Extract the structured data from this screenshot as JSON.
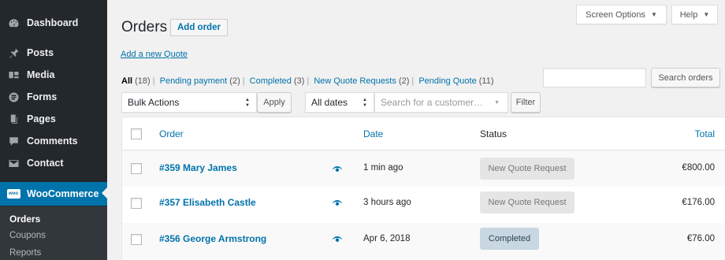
{
  "sidebar": {
    "items": [
      {
        "label": "Dashboard",
        "icon": "dashboard-icon"
      },
      {
        "label": "Posts",
        "icon": "pin-icon"
      },
      {
        "label": "Media",
        "icon": "media-icon"
      },
      {
        "label": "Forms",
        "icon": "forms-icon"
      },
      {
        "label": "Pages",
        "icon": "pages-icon"
      },
      {
        "label": "Comments",
        "icon": "comment-icon"
      },
      {
        "label": "Contact",
        "icon": "mail-icon"
      },
      {
        "label": "WooCommerce",
        "icon": "woocommerce-icon",
        "badge": "woo"
      }
    ],
    "submenu": [
      "Orders",
      "Coupons",
      "Reports"
    ]
  },
  "top": {
    "screen_options": "Screen Options",
    "help": "Help"
  },
  "header": {
    "title": "Orders",
    "add_order": "Add order",
    "quote_link": "Add a new Quote"
  },
  "filters": {
    "views": [
      {
        "label": "All",
        "count": "(18)"
      },
      {
        "label": "Pending payment",
        "count": "(2)"
      },
      {
        "label": "Completed",
        "count": "(3)"
      },
      {
        "label": "New Quote Requests",
        "count": "(2)"
      },
      {
        "label": "Pending Quote",
        "count": "(11)"
      }
    ],
    "search_button": "Search orders",
    "bulk_actions": "Bulk Actions",
    "apply": "Apply",
    "all_dates": "All dates",
    "customer_placeholder": "Search for a customer…",
    "filter": "Filter"
  },
  "table": {
    "headers": {
      "order": "Order",
      "date": "Date",
      "status": "Status",
      "total": "Total"
    },
    "rows": [
      {
        "order": "#359 Mary James",
        "date": "1 min ago",
        "status": "New Quote Request",
        "total": "€800.00"
      },
      {
        "order": "#357 Elisabeth Castle",
        "date": "3 hours ago",
        "status": "New Quote Request",
        "total": "€176.00"
      },
      {
        "order": "#356 George Armstrong",
        "date": "Apr 6, 2018",
        "status": "Completed",
        "total": "€76.00"
      }
    ]
  },
  "colors": {
    "sidebar": "#23282d",
    "accent": "#0073aa",
    "completed": "#c8d7e1"
  }
}
